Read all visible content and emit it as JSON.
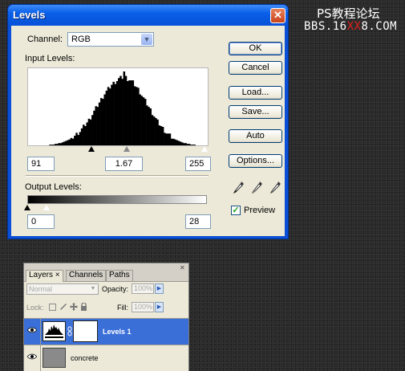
{
  "watermark": {
    "line1": "PS教程论坛",
    "line2_a": "BBS.16",
    "line2_red": "XX",
    "line2_b": "8.COM"
  },
  "dialog": {
    "title": "Levels",
    "close_glyph": "✕",
    "channel_label": "Channel:",
    "channel_value": "RGB",
    "input_levels_label": "Input Levels:",
    "input_black": "91",
    "input_gamma": "1.67",
    "input_white": "255",
    "output_levels_label": "Output Levels:",
    "output_black": "0",
    "output_white": "28",
    "buttons": {
      "ok": "OK",
      "cancel": "Cancel",
      "load": "Load...",
      "save": "Save...",
      "auto": "Auto",
      "options": "Options..."
    },
    "preview_label": "Preview",
    "preview_checked": true,
    "histogram": {
      "description_bins": [
        0,
        0,
        0,
        0,
        0,
        0,
        0,
        0,
        0,
        0,
        0,
        0,
        1,
        1,
        1,
        2,
        2,
        3,
        3,
        4,
        5,
        6,
        7,
        8,
        10,
        11,
        13,
        15,
        17,
        19,
        22,
        25,
        28,
        31,
        34,
        38,
        42,
        46,
        50,
        54,
        58,
        62,
        66,
        70,
        73,
        76,
        79,
        82,
        84,
        86,
        88,
        90,
        91,
        92,
        100,
        92,
        90,
        89,
        87,
        85,
        82,
        79,
        76,
        72,
        68,
        64,
        60,
        56,
        52,
        48,
        44,
        40,
        36,
        32,
        29,
        26,
        23,
        20,
        17,
        15,
        13,
        11,
        9,
        8,
        7,
        6,
        5,
        4,
        3,
        3,
        2,
        2,
        1,
        1,
        1,
        0,
        0,
        0,
        0,
        0,
        0,
        0
      ]
    }
  },
  "layers_panel": {
    "tabs": [
      "Layers",
      "Channels",
      "Paths"
    ],
    "tab_close": "×",
    "blend_mode": "Normal",
    "opacity_label": "Opacity:",
    "opacity_value": "100%",
    "lock_label": "Lock:",
    "fill_label": "Fill:",
    "fill_value": "100%",
    "layers": [
      {
        "name": "Levels 1",
        "selected": true
      },
      {
        "name": "concrete",
        "selected": false
      }
    ]
  },
  "colors": {
    "titlebar_blue": "#0a5fe8",
    "dialog_bg": "#ece9d8",
    "selected_layer": "#3a6fd8",
    "watermark_red": "#e0201a"
  }
}
